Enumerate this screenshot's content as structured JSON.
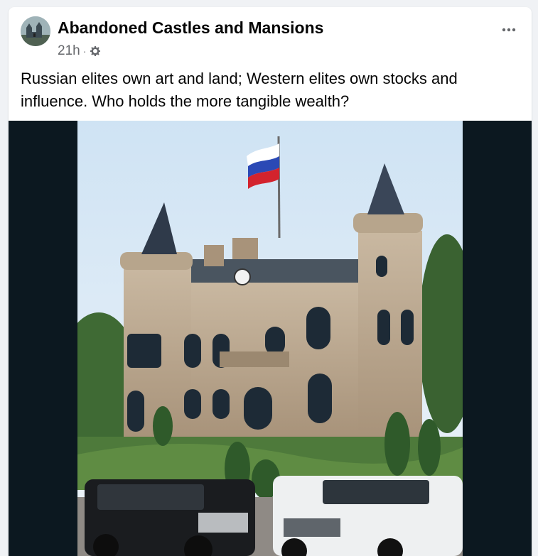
{
  "post": {
    "page_name": "Abandoned Castles and Mansions",
    "time": "21h",
    "separator": "·",
    "privacy_icon": "gear-icon",
    "more_icon": "more-dots-icon",
    "text": "Russian elites own art and land; Western elites own stocks and influence. Who holds the more tangible wealth?"
  },
  "media": {
    "description_icon": "castle-photo"
  },
  "colors": {
    "text_primary": "#050505",
    "text_secondary": "#65676b",
    "media_background": "#0c1820"
  }
}
